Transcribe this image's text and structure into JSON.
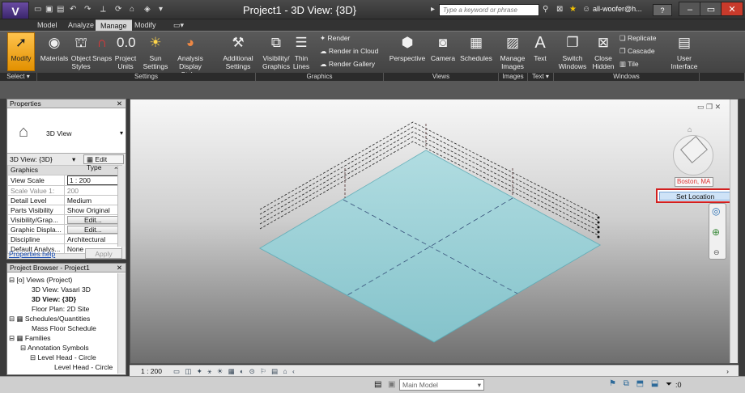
{
  "titlebar": {
    "app_letter": "V",
    "title": "Project1 - 3D View: {3D}",
    "search_placeholder": "Type a keyword or phrase",
    "user": "all-woofer@h...",
    "help": "?"
  },
  "tabs": [
    "Model",
    "Analyze",
    "Manage",
    "Modify"
  ],
  "active_tab": "Manage",
  "ribbon": {
    "modify": "Modify",
    "select_panel": "Select",
    "settings_panel": "Settings",
    "graphics_panel": "Graphics",
    "views_panel": "Views",
    "images_panel": "Images",
    "text_panel": "Text",
    "windows_panel": "Windows",
    "buttons": {
      "materials": "Materials",
      "object_styles": "Object Styles",
      "snaps": "Snaps",
      "project_units": "Project Units",
      "sun_settings": "Sun Settings",
      "analysis_display": "Analysis Display Styles",
      "additional_settings": "Additional Settings",
      "visibility_graphics": "Visibility/ Graphics",
      "thin_lines": "Thin Lines",
      "render": "Render",
      "render_cloud": "Render in Cloud",
      "render_gallery": "Render Gallery",
      "perspective": "Perspective",
      "camera": "Camera",
      "schedules": "Schedules",
      "manage_images": "Manage Images",
      "text": "Text",
      "switch_windows": "Switch Windows",
      "close_hidden": "Close Hidden",
      "replicate": "Replicate",
      "cascade": "Cascade",
      "tile": "Tile",
      "user_interface": "User Interface"
    }
  },
  "properties": {
    "title": "Properties",
    "type_name": "3D View",
    "view_selector": "3D View: {3D}",
    "edit_type": "Edit Type",
    "rows": [
      {
        "group": "Graphics"
      },
      {
        "label": "View Scale",
        "value": "1 : 200"
      },
      {
        "label": "Scale Value    1:",
        "value": "200"
      },
      {
        "label": "Detail Level",
        "value": "Medium"
      },
      {
        "label": "Parts Visibility",
        "value": "Show Original"
      },
      {
        "label": "Visibility/Grap...",
        "value": "Edit..."
      },
      {
        "label": "Graphic Displa...",
        "value": "Edit..."
      },
      {
        "label": "Discipline",
        "value": "Architectural"
      },
      {
        "label": "Default Analys...",
        "value": "None"
      }
    ],
    "help_link": "Properties help",
    "apply": "Apply"
  },
  "browser": {
    "title": "Project Browser - Project1",
    "items": [
      {
        "text": "Views (Project)",
        "level": 0,
        "bold": false
      },
      {
        "text": "3D View: Vasari 3D",
        "level": 1,
        "bold": false
      },
      {
        "text": "3D View: {3D}",
        "level": 1,
        "bold": true
      },
      {
        "text": "Floor Plan: 2D Site",
        "level": 1,
        "bold": false
      },
      {
        "text": "Schedules/Quantities",
        "level": 0,
        "bold": false
      },
      {
        "text": "Mass Floor Schedule",
        "level": 1,
        "bold": false
      },
      {
        "text": "Families",
        "level": 0,
        "bold": false
      },
      {
        "text": "Annotation Symbols",
        "level": 1,
        "bold": false
      },
      {
        "text": "Level Head - Circle",
        "level": 2,
        "bold": false
      },
      {
        "text": "Level Head - Circle",
        "level": 3,
        "bold": false
      }
    ]
  },
  "viewport": {
    "location": "Boston, MA",
    "set_location": "Set Location",
    "scale": "1 : 200"
  },
  "statusbar": {
    "model": "Main Model",
    "filter_count": ":0"
  },
  "colors": {
    "accent": "#e29000",
    "highlight_red": "#d21f1f",
    "plane_fill": "#8ed3da"
  }
}
